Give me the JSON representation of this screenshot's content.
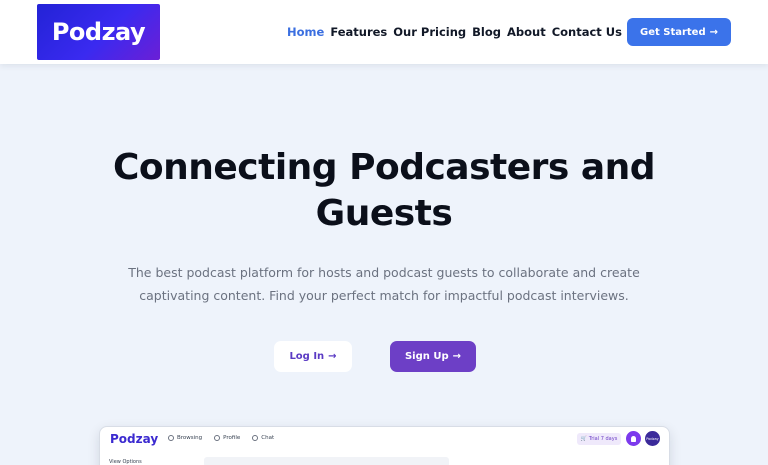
{
  "header": {
    "logo_text": "Podzay",
    "nav": [
      {
        "label": "Home",
        "active": true
      },
      {
        "label": "Features",
        "active": false
      },
      {
        "label": "Our Pricing",
        "active": false
      },
      {
        "label": "Blog",
        "active": false
      },
      {
        "label": "About",
        "active": false
      },
      {
        "label": "Contact Us",
        "active": false
      }
    ],
    "cta_label": "Get Started",
    "cta_arrow": "→"
  },
  "hero": {
    "title_line1": "Connecting Podcasters and",
    "title_line2": "Guests",
    "subtitle_line1": "The best podcast platform for hosts and podcast guests to collaborate and create",
    "subtitle_line2": "captivating content. Find your perfect match for impactful podcast interviews.",
    "login_label": "Log In",
    "signup_label": "Sign Up",
    "arrow": "→"
  },
  "preview": {
    "logo_text": "Podzay",
    "nav": [
      {
        "label": "Browsing",
        "icon": "compass-icon"
      },
      {
        "label": "Profile",
        "icon": "user-icon"
      },
      {
        "label": "Chat",
        "icon": "chat-icon"
      }
    ],
    "trial_label": "Trial 7 days",
    "avatar_text": "Podzay",
    "view_options_label": "View Options"
  },
  "colors": {
    "accent_blue": "#3b73ea",
    "accent_purple": "#6d3fc6",
    "background": "#eef3fb"
  }
}
